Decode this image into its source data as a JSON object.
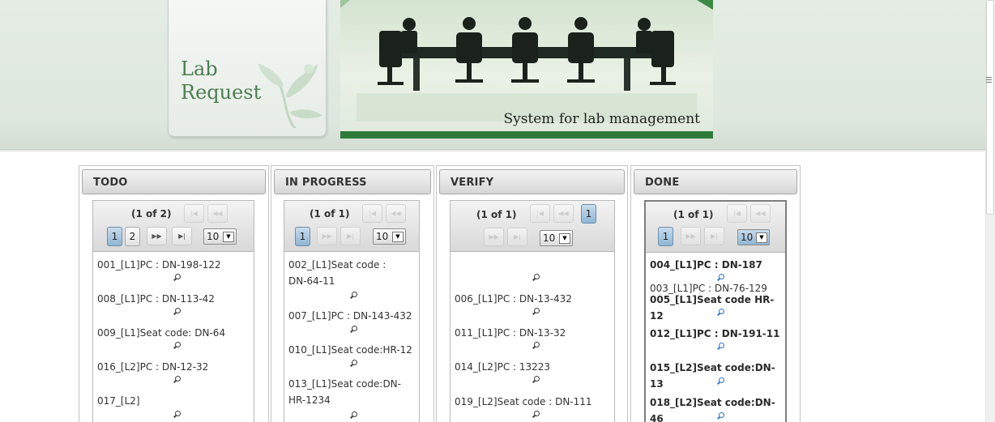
{
  "logo": {
    "line1": "Lab",
    "line2": "Request"
  },
  "banner": {
    "caption": "System for lab management"
  },
  "columns": [
    {
      "title": "TODO",
      "pager": {
        "report": "(1 of 2)",
        "pages": [
          "1",
          "2"
        ],
        "current": "1",
        "rows_per_page": "10"
      },
      "items": [
        "001_[L1]PC : DN-198-122",
        "008_[L1]PC : DN-113-42",
        "009_[L1]Seat code: DN-64",
        "016_[L2]PC : DN-12-32",
        "017_[L2]"
      ]
    },
    {
      "title": "IN PROGRESS",
      "pager": {
        "report": "(1 of 1)",
        "pages": [
          "1"
        ],
        "current": "1",
        "rows_per_page": "10"
      },
      "items": [
        "002_[L1]Seat code : DN-64-11",
        "007_[L1]PC : DN-143-432",
        "010_[L1]Seat code:HR-12",
        "013_[L1]Seat code:DN-HR-1234"
      ]
    },
    {
      "title": "VERIFY",
      "pager": {
        "report": "(1 of 1)",
        "pages": [
          "1"
        ],
        "current": "1",
        "rows_per_page": "10"
      },
      "items": [
        "",
        "006_[L1]PC : DN-13-432",
        "011_[L1]PC : DN-13-32",
        "014_[L2]PC : 13223",
        "019_[L2]Seat code : DN-111"
      ]
    },
    {
      "title": "DONE",
      "pager": {
        "report": "(1 of 1)",
        "pages": [
          "1"
        ],
        "current": "1",
        "rows_per_page": "10"
      },
      "items": [
        "004_[L1]PC : DN-187",
        "003_[L1]PC : DN-76-129",
        "005_[L1]Seat code HR-12",
        "012_[L1]PC : DN-191-11",
        "015_[L2]Seat code:DN-13",
        "018_[L2]Seat code:DN-46"
      ]
    }
  ],
  "colors": {
    "accent_green": "#2d7a3b",
    "logo_green": "#4c7d52",
    "selected_blue": "#8fb5d4"
  },
  "icons": {
    "item_detail": "magnifier-icon",
    "first_page": "first-page-icon",
    "prev_page": "prev-page-icon",
    "next_page": "next-page-icon",
    "last_page": "last-page-icon"
  }
}
